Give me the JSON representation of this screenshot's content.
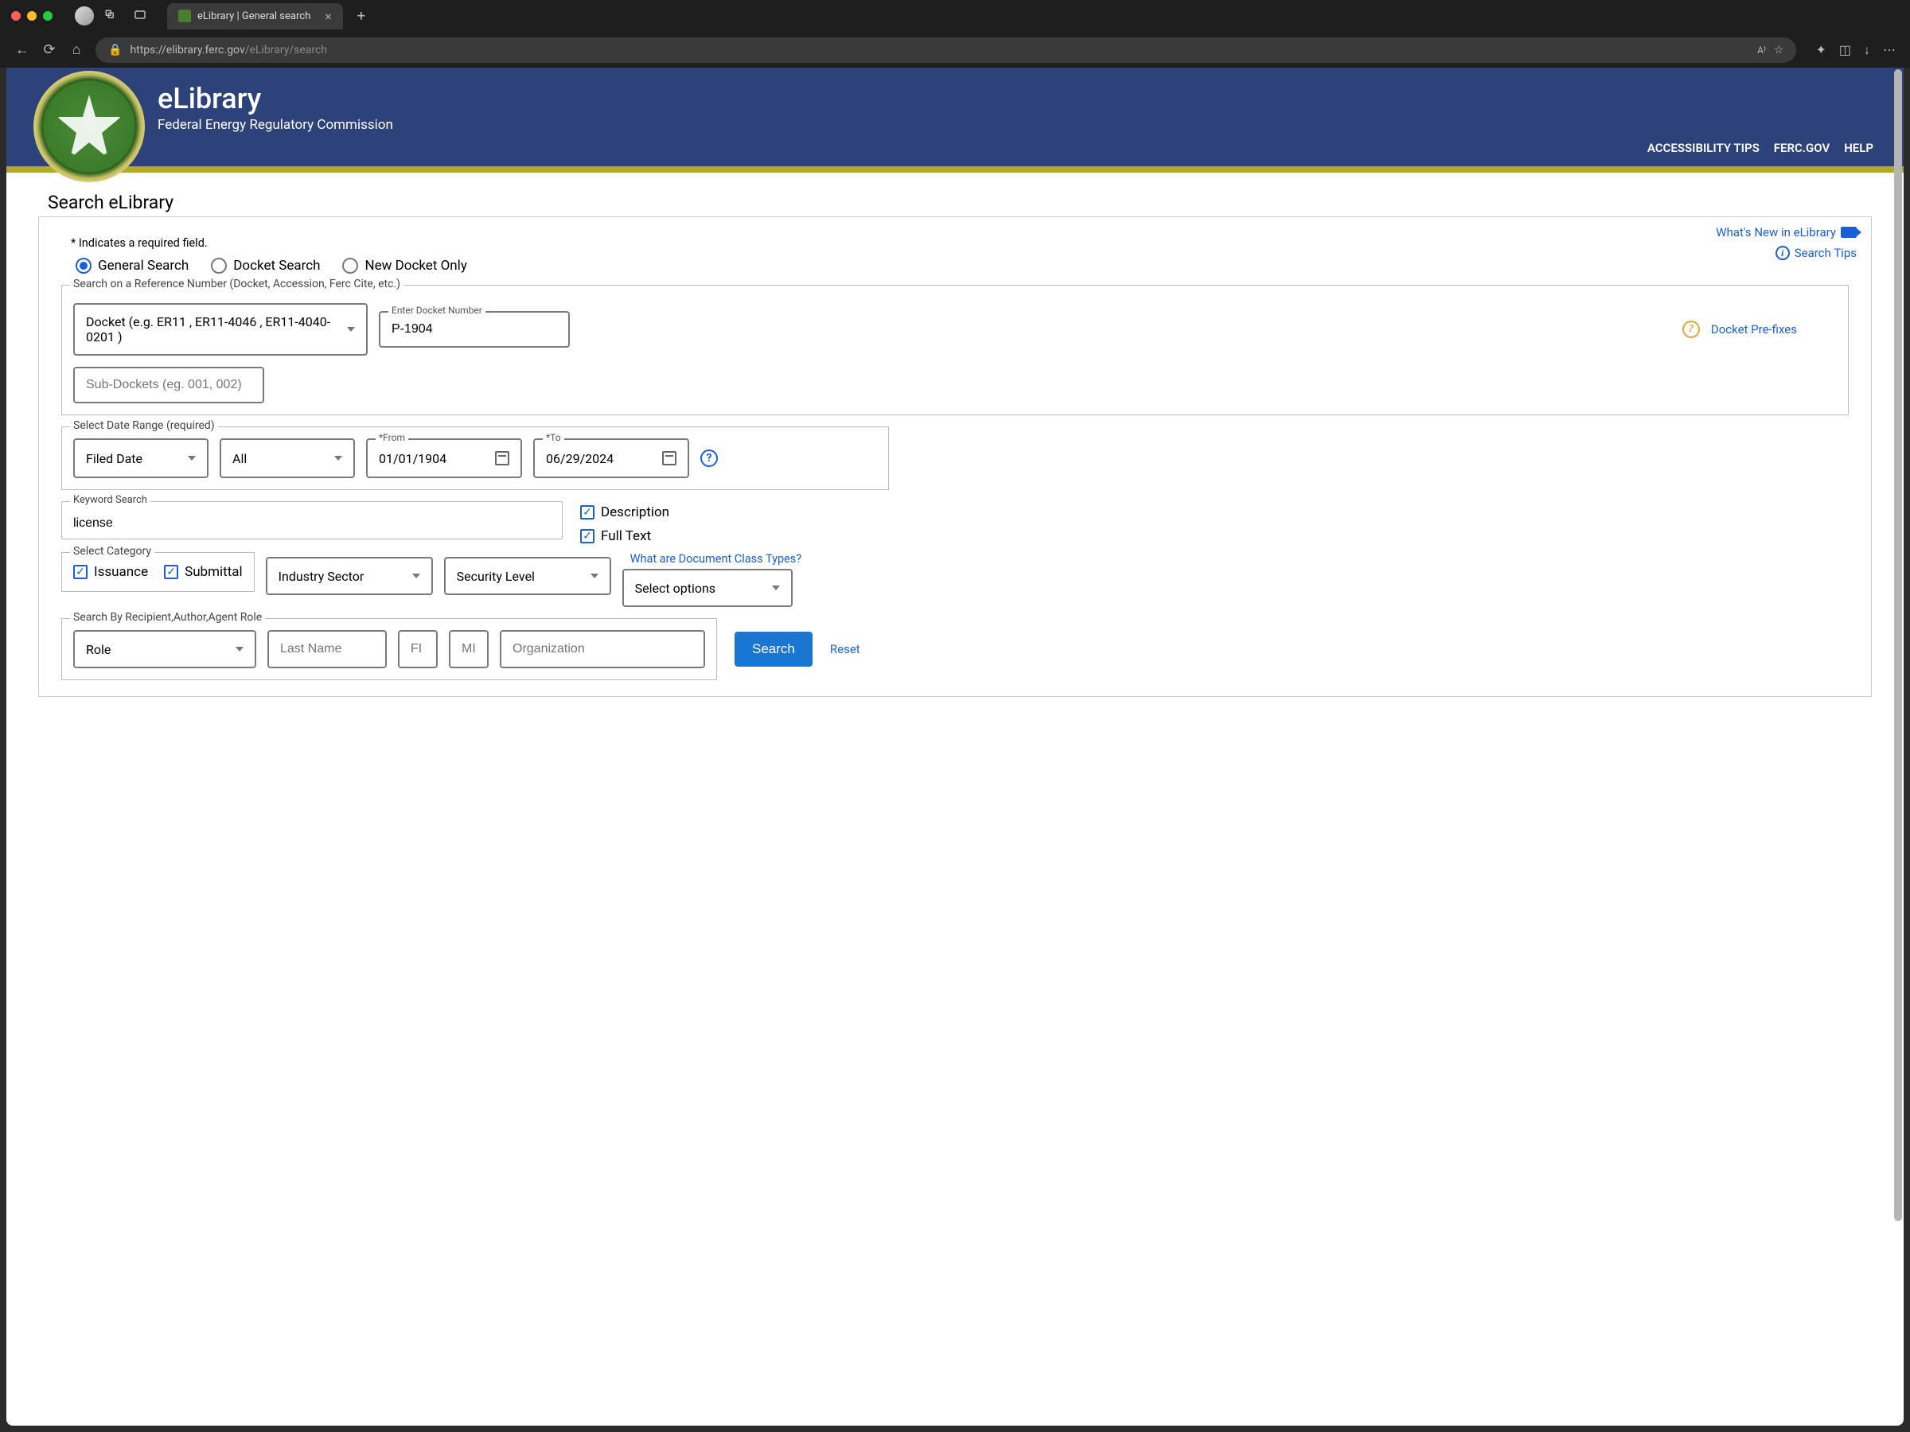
{
  "browser": {
    "tab_title": "eLibrary | General search",
    "url_host": "https://elibrary.ferc.gov",
    "url_path": "/eLibrary/search"
  },
  "header": {
    "brand_title": "eLibrary",
    "brand_subtitle": "Federal Energy Regulatory Commission",
    "nav": {
      "accessibility": "ACCESSIBILITY TIPS",
      "ferc": "FERC.GOV",
      "help": "HELP"
    }
  },
  "page": {
    "title": "Search eLibrary",
    "whats_new": "What's New in eLibrary",
    "search_tips": "Search Tips",
    "required_note": "* Indicates a required field.",
    "radios": {
      "general": "General Search",
      "docket": "Docket Search",
      "newdocket": "New Docket Only"
    },
    "ref_section": {
      "legend": "Search on a Reference Number (Docket, Accession, Ferc Cite, etc.)",
      "docket_select": "Docket (e.g. ER11 , ER11-4046 , ER11-4040-0201 )",
      "enter_docket_label": "Enter Docket Number",
      "enter_docket_value": "P-1904",
      "subdocket_placeholder": "Sub-Dockets (eg. 001, 002)",
      "docket_prefixes": "Docket Pre-fixes"
    },
    "date_section": {
      "legend": "Select Date Range (required)",
      "filed": "Filed Date",
      "all": "All",
      "from_label": "*From",
      "from_value": "01/01/1904",
      "to_label": "*To",
      "to_value": "06/29/2024"
    },
    "keyword": {
      "legend": "Keyword Search",
      "value": "license",
      "description": "Description",
      "fulltext": "Full Text"
    },
    "category": {
      "legend": "Select Category",
      "issuance": "Issuance",
      "submittal": "Submittal",
      "industry": "Industry Sector",
      "security": "Security Level",
      "class_link": "What are Document Class Types?",
      "class_select": "Select options"
    },
    "role_section": {
      "legend": "Search By Recipient,Author,Agent Role",
      "role": "Role",
      "lastname": "Last Name",
      "fi": "FI",
      "mi": "MI",
      "org": "Organization"
    },
    "actions": {
      "search": "Search",
      "reset": "Reset"
    }
  }
}
